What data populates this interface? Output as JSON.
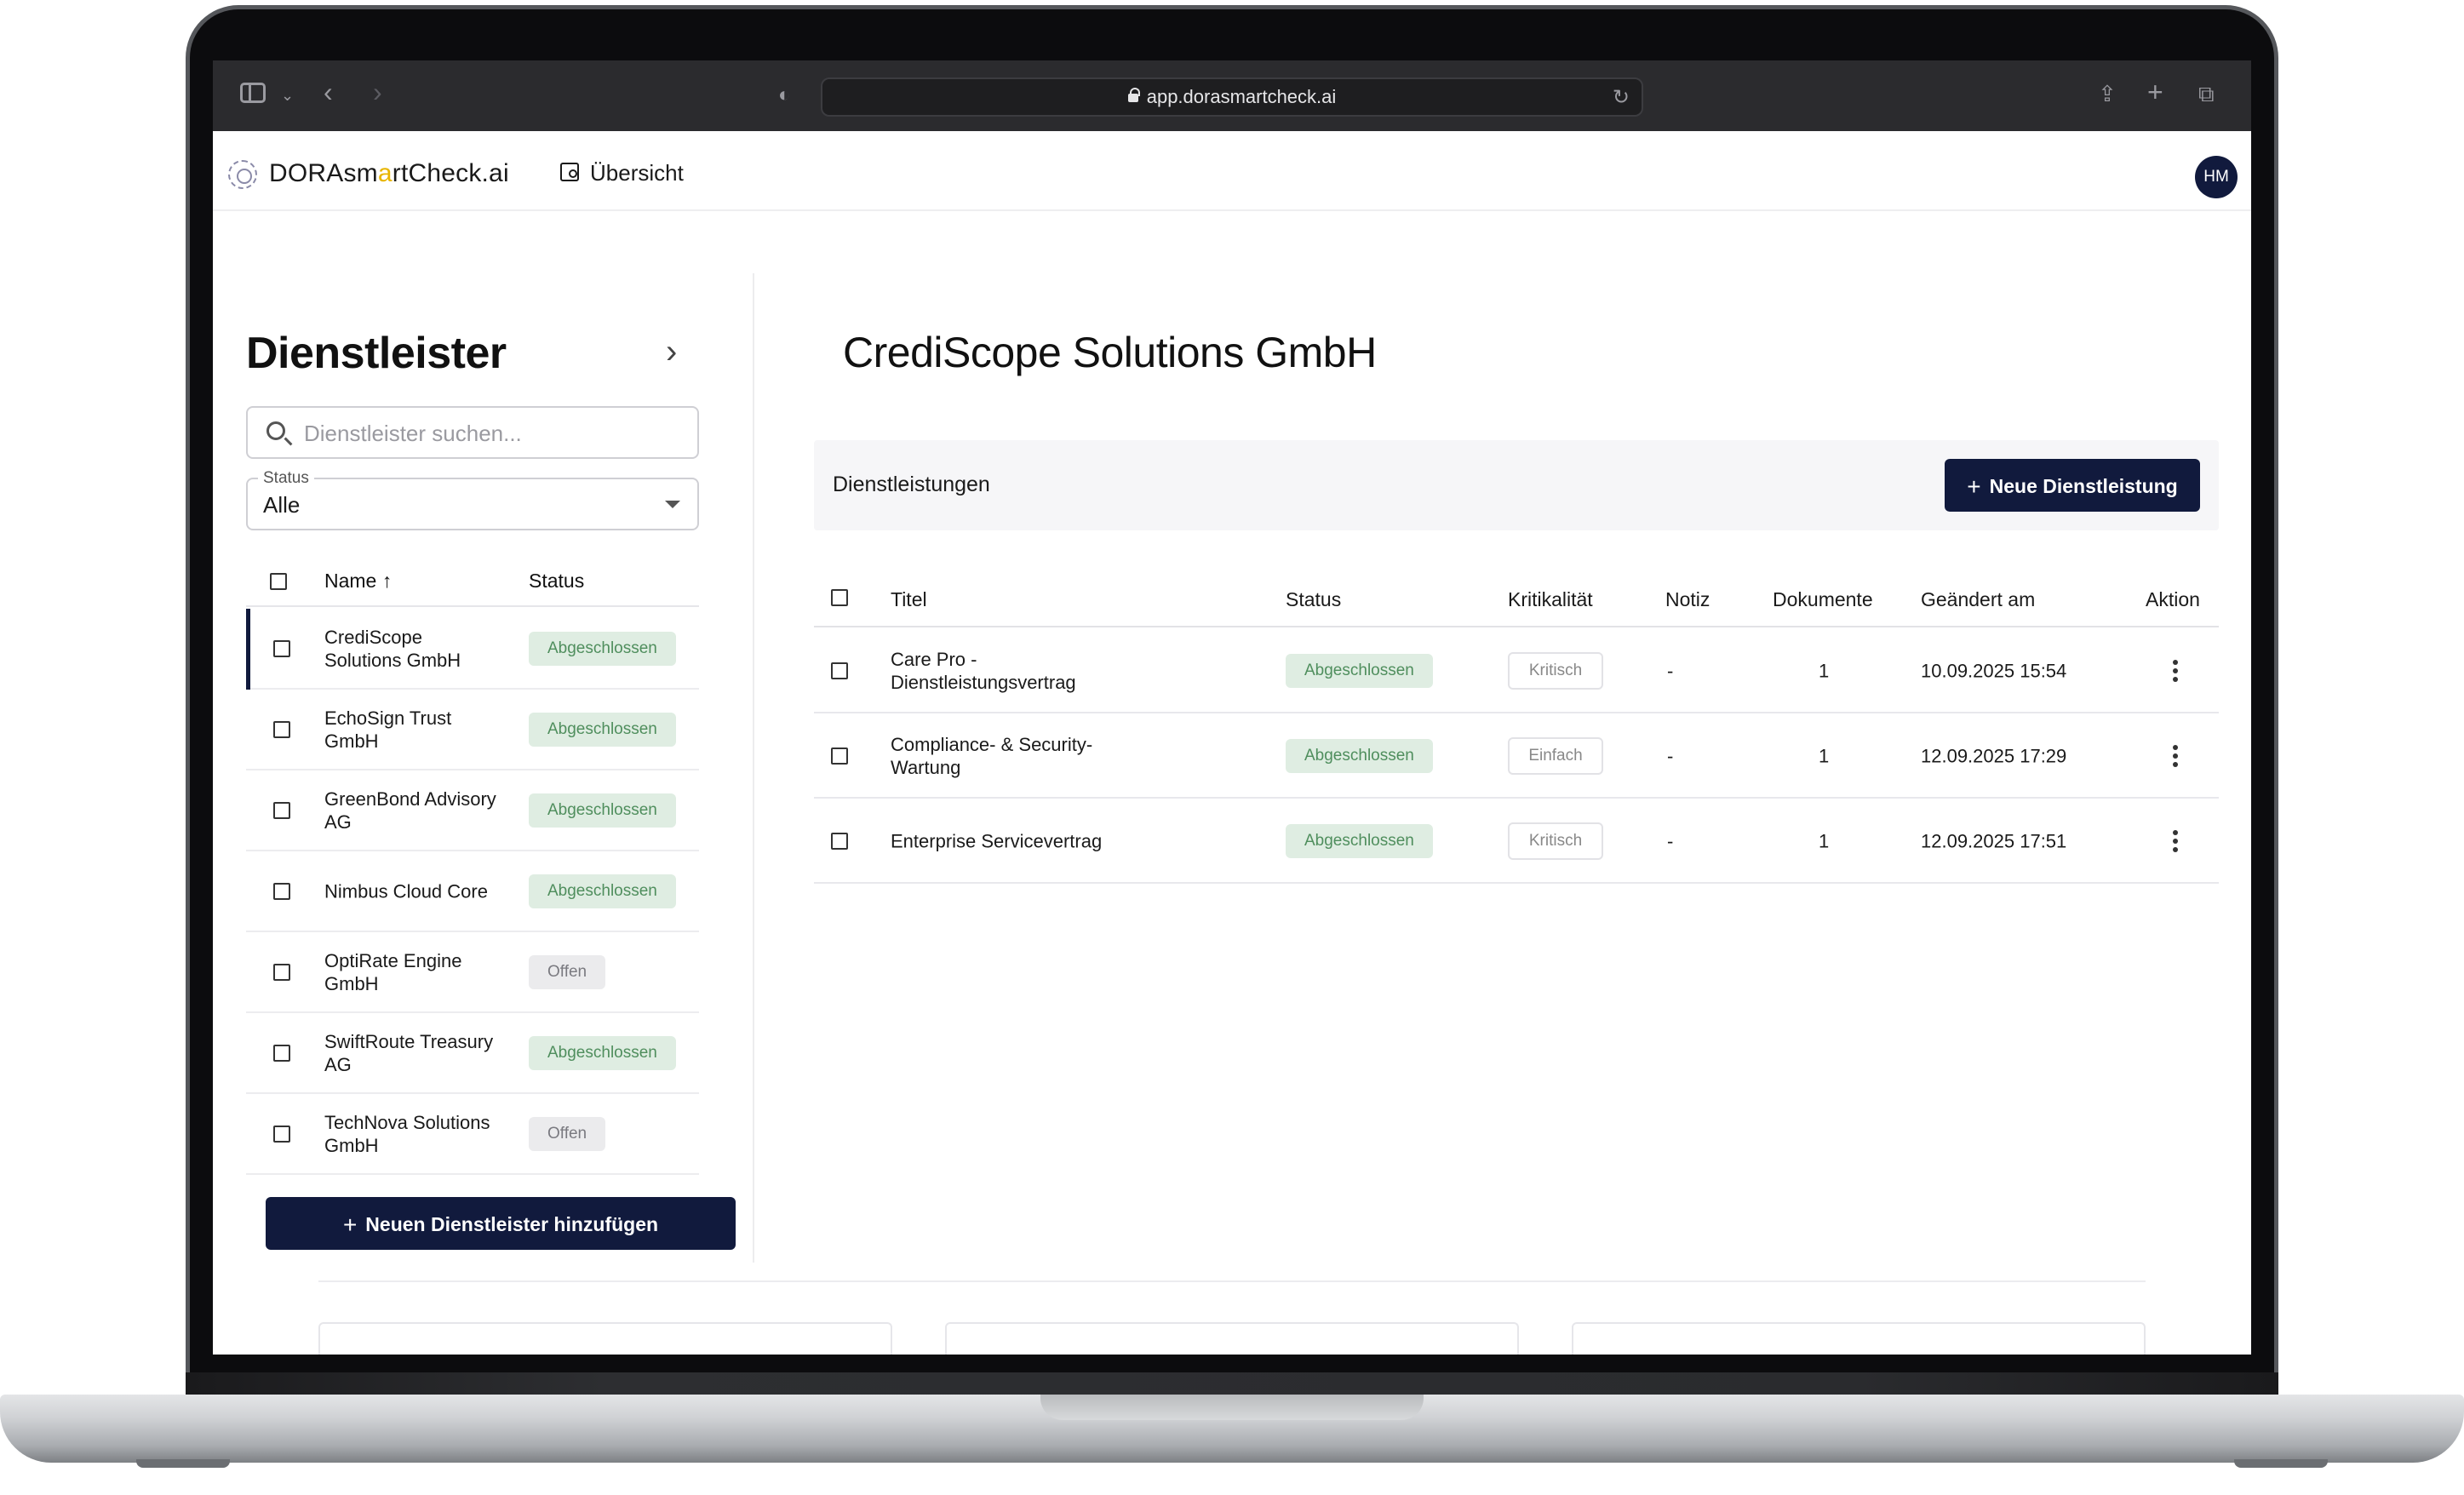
{
  "browser": {
    "url": "app.dorasmartcheck.ai"
  },
  "app": {
    "brand_prefix": "DORAsm",
    "brand_accent": "a",
    "brand_suffix": "rtCheck.ai",
    "nav_overview": "Übersicht",
    "avatar_initials": "HM"
  },
  "providers_panel": {
    "title": "Dienstleister",
    "search_placeholder": "Dienstleister suchen...",
    "status_label": "Status",
    "status_value": "Alle",
    "col_name": "Name ↑",
    "col_status": "Status",
    "items": [
      {
        "name": "CrediScope Solutions GmbH",
        "status": "Abgeschlossen",
        "kind": "done",
        "active": true
      },
      {
        "name": "EchoSign Trust GmbH",
        "status": "Abgeschlossen",
        "kind": "done"
      },
      {
        "name": "GreenBond Advisory AG",
        "status": "Abgeschlossen",
        "kind": "done"
      },
      {
        "name": "Nimbus Cloud Core",
        "status": "Abgeschlossen",
        "kind": "done"
      },
      {
        "name": "OptiRate Engine GmbH",
        "status": "Offen",
        "kind": "open"
      },
      {
        "name": "SwiftRoute Treasury AG",
        "status": "Abgeschlossen",
        "kind": "done"
      },
      {
        "name": "TechNova Solutions GmbH",
        "status": "Offen",
        "kind": "open"
      }
    ],
    "add_button": "Neuen Dienstleister hinzufügen"
  },
  "detail": {
    "title": "CrediScope Solutions GmbH",
    "services_label": "Dienstleistungen",
    "new_service_button": "Neue Dienstleistung",
    "columns": {
      "title": "Titel",
      "status": "Status",
      "criticality": "Kritikalität",
      "note": "Notiz",
      "documents": "Dokumente",
      "changed": "Geändert am",
      "action": "Aktion"
    },
    "rows": [
      {
        "title_line1": "Care Pro -",
        "title_line2": "Dienstleistungsvertrag",
        "status": "Abgeschlossen",
        "criticality": "Kritisch",
        "note": "-",
        "documents": "1",
        "changed": "10.09.2025 15:54"
      },
      {
        "title_line1": "Compliance- & Security-",
        "title_line2": "Wartung",
        "status": "Abgeschlossen",
        "criticality": "Einfach",
        "note": "-",
        "documents": "1",
        "changed": "12.09.2025 17:29"
      },
      {
        "title_line1": "Enterprise Servicevertrag",
        "title_line2": "",
        "status": "Abgeschlossen",
        "criticality": "Kritisch",
        "note": "-",
        "documents": "1",
        "changed": "12.09.2025 17:51"
      }
    ]
  },
  "colors": {
    "primary": "#111a3d",
    "status_done_bg": "#dfede2",
    "status_done_text": "#4f8e5d",
    "status_open_bg": "#ebebed",
    "brand_accent": "#e8b500"
  }
}
